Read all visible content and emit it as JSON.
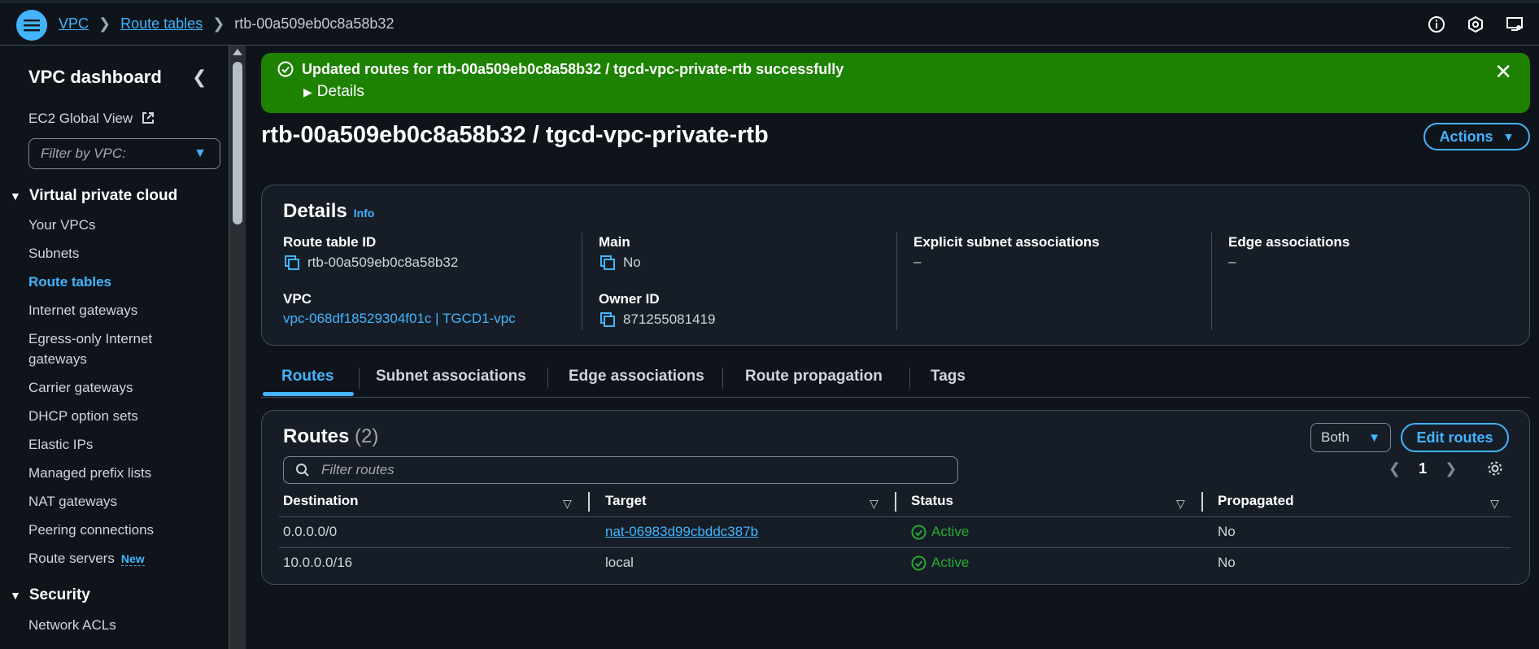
{
  "breadcrumb": {
    "items": [
      "VPC",
      "Route tables"
    ],
    "current": "rtb-00a509eb0c8a58b32"
  },
  "topbar": {
    "icons": [
      "info-icon",
      "cloudshell-icon",
      "display-settings-icon"
    ]
  },
  "sidebar": {
    "title": "VPC dashboard",
    "ec2_global_view": "EC2 Global View",
    "filter_placeholder": "Filter by VPC:",
    "section_vpc": "Virtual private cloud",
    "items": [
      "Your VPCs",
      "Subnets",
      "Route tables",
      "Internet gateways",
      "Egress-only Internet",
      "gateways",
      "Carrier gateways",
      "DHCP option sets",
      "Elastic IPs",
      "Managed prefix lists",
      "NAT gateways",
      "Peering connections",
      "Route servers"
    ],
    "new_badge": "New",
    "section_security": "Security",
    "security_items": [
      "Network ACLs"
    ]
  },
  "flash": {
    "message": "Updated routes for rtb-00a509eb0c8a58b32 / tgcd-vpc-private-rtb successfully",
    "details": "Details",
    "color": "#1d8102"
  },
  "page": {
    "title": "rtb-00a509eb0c8a58b32 / tgcd-vpc-private-rtb",
    "actions": "Actions"
  },
  "details": {
    "heading": "Details",
    "info": "Info",
    "route_table_id_label": "Route table ID",
    "route_table_id": "rtb-00a509eb0c8a58b32",
    "main_label": "Main",
    "main": "No",
    "explicit_label": "Explicit subnet associations",
    "explicit": "–",
    "edge_label": "Edge associations",
    "edge": "–",
    "vpc_label": "VPC",
    "vpc": "vpc-068df18529304f01c | TGCD1-vpc",
    "owner_label": "Owner ID",
    "owner": "871255081419"
  },
  "tabs": [
    "Routes",
    "Subnet associations",
    "Edge associations",
    "Route propagation",
    "Tags"
  ],
  "routes": {
    "heading": "Routes",
    "count": "(2)",
    "both": "Both",
    "edit": "Edit routes",
    "filter_placeholder": "Filter routes",
    "page": "1",
    "columns": [
      "Destination",
      "Target",
      "Status",
      "Propagated"
    ],
    "rows": [
      {
        "destination": "0.0.0.0/0",
        "target": "nat-06983d99cbddc387b",
        "status": "Active",
        "propagated": "No"
      },
      {
        "destination": "10.0.0.0/16",
        "target": "local",
        "status": "Active",
        "propagated": "No"
      }
    ]
  },
  "colors": {
    "accent": "#42b4ff",
    "success": "#29ad32",
    "background": "#0f141a"
  }
}
